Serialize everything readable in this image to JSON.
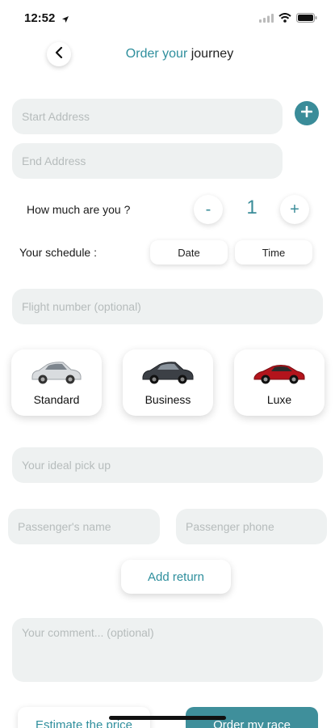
{
  "status": {
    "time": "12:52"
  },
  "header": {
    "title_accent": "Order your",
    "title_plain": "journey"
  },
  "form": {
    "start_placeholder": "Start Address",
    "end_placeholder": "End Address",
    "passengers_label": "How much are you ?",
    "passenger_count": "1",
    "minus": "-",
    "plus": "+",
    "schedule_label": "Your schedule :",
    "date_label": "Date",
    "time_label": "Time",
    "flight_placeholder": "Flight number (optional)",
    "pickup_placeholder": "Your ideal pick up",
    "passenger_name_placeholder": "Passenger's name",
    "passenger_phone_placeholder": "Passenger phone",
    "add_return_label": "Add return",
    "comment_placeholder": "Your comment... (optional)"
  },
  "cars": [
    {
      "label": "Standard",
      "color": "#d9dcdf"
    },
    {
      "label": "Business",
      "color": "#3c4046"
    },
    {
      "label": "Luxe",
      "color": "#b3141c"
    }
  ],
  "actions": {
    "estimate_label": "Estimate the price",
    "order_label": "Order my race"
  },
  "colors": {
    "accent": "#3a8c99",
    "field_bg": "#eef1f1"
  }
}
